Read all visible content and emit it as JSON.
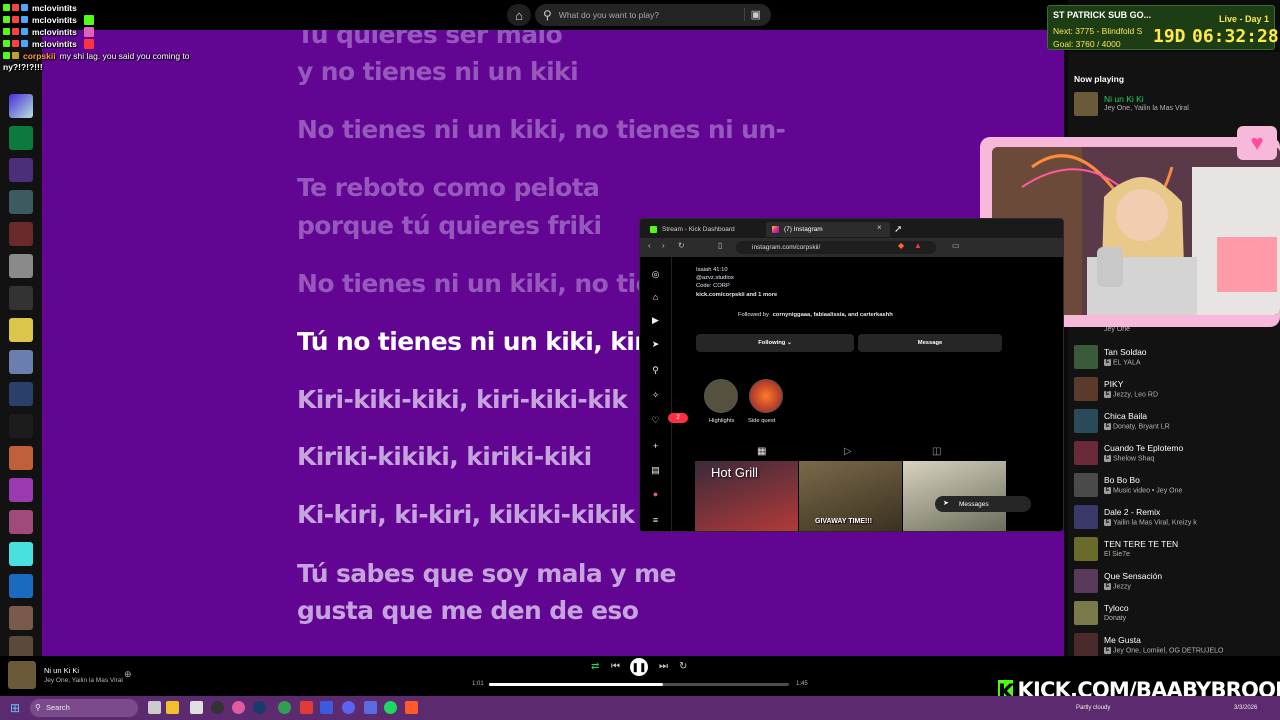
{
  "spotify": {
    "search_placeholder": "What do you want to play?",
    "lyrics": [
      {
        "text": "Tú quieres ser malo",
        "state": "past"
      },
      {
        "text": "y no tienes ni un kiki",
        "state": "past"
      },
      {
        "text": "No tienes ni un kiki, no tienes ni un-",
        "state": "past"
      },
      {
        "text": "Te reboto como pelota",
        "state": "past"
      },
      {
        "text": "porque tú quieres friki",
        "state": "past"
      },
      {
        "text": "No tienes ni un kiki, no tie",
        "state": "past"
      },
      {
        "text": "Tú no tienes ni un kiki, kiri",
        "state": "active"
      },
      {
        "text": "Kiri-kiki-kiki, kiri-kiki-kik",
        "state": "upcoming"
      },
      {
        "text": "Kiriki-kikiki, kiriki-kiki",
        "state": "upcoming"
      },
      {
        "text": "Ki-kiri, ki-kiri, kikiki-kikik",
        "state": "upcoming"
      },
      {
        "text": "Tú sabes que soy mala y me",
        "state": "upcoming"
      },
      {
        "text": "gusta que me den de eso",
        "state": "upcoming"
      }
    ],
    "queue": {
      "now_playing_heading": "Now playing",
      "now_playing": {
        "title": "Ni un Ki Ki",
        "artist": "Jey One, Yailin la Mas Viral"
      },
      "items": [
        {
          "title": "",
          "artist": "Jey One",
          "explicit": false
        },
        {
          "title": "Tan Soldao",
          "artist": "EL YALA",
          "explicit": true
        },
        {
          "title": "PIKY",
          "artist": "Jezzy, Leo RD",
          "explicit": true
        },
        {
          "title": "Chica Baila",
          "artist": "Donaty, Bryant LR",
          "explicit": true
        },
        {
          "title": "Cuando Te Eplotemo",
          "artist": "Shelow Shaq",
          "explicit": true
        },
        {
          "title": "Bo Bo Bo",
          "artist": "Music video • Jey One",
          "explicit": true
        },
        {
          "title": "Dale 2 - Remix",
          "artist": "Yailin la Mas Viral, Kreizy k",
          "explicit": true
        },
        {
          "title": "TEN TERE TE TEN",
          "artist": "El Sie7e",
          "explicit": false
        },
        {
          "title": "Que Sensación",
          "artist": "Jezzy",
          "explicit": true
        },
        {
          "title": "Tyloco",
          "artist": "Donaty",
          "explicit": false
        },
        {
          "title": "Me Gusta",
          "artist": "Jey One, Lomiiel, OG DETRUJELO",
          "explicit": true
        }
      ]
    },
    "player": {
      "title": "Ni un Ki Ki",
      "artist": "Jey One, Yailin la Mas Viral",
      "elapsed": "1:01",
      "duration": "1:45",
      "progress": 0.58
    }
  },
  "chat": {
    "lines": [
      {
        "user": "mclovintits",
        "message": "",
        "highlight": false
      },
      {
        "user": "mclovintits",
        "message": "",
        "highlight": false
      },
      {
        "user": "mclovintits",
        "message": "",
        "highlight": false
      },
      {
        "user": "mclovintits",
        "message": "",
        "highlight": false
      },
      {
        "user": "corpskii",
        "message": "my shi lag. you said you coming to",
        "highlight": true
      }
    ],
    "continuation": "ny?!?!?!!!"
  },
  "subathon": {
    "title": "ST PATRICK SUB GO...",
    "status": "Live - Day 1",
    "next": "Next: 3775 - Blindfold S",
    "goal": "Goal: 3760 / 4000",
    "days": "19D",
    "time": "06:32:28"
  },
  "browser": {
    "tabs": [
      {
        "label": "Stream - Kick Dashboard",
        "active": false
      },
      {
        "label": "(7) Instagram",
        "active": true
      }
    ],
    "url": "instagram.com/corpskii/",
    "profile": {
      "name_line": "Isaiah 41:10",
      "handle": "@azvz.studios",
      "code_line": "Code: CORP",
      "link_line": "kick.com/corpskii and 1 more",
      "followed_by": "Followed by",
      "followers_names": "cornyniggaaa, fabiaalissia, and carterkashh",
      "following_label": "Following",
      "message_label": "Message",
      "highlights": [
        {
          "label": "Highlights"
        },
        {
          "label": "Side quest"
        }
      ],
      "post_overlay_1": "Hot Grill",
      "post_overlay_2": "GIVAWAY TIME!!!",
      "messages_label": "Messages",
      "notif_count": "2"
    }
  },
  "kick_banner": {
    "text": "KICK.COM/BAABYBROOK",
    "brand_color": "#53fc18"
  },
  "taskbar": {
    "search_label": "Search",
    "weather": "Partly cloudy",
    "date": "3/3/2026"
  },
  "colors": {
    "lyrics_bg": "#610592",
    "spotify_green": "#1ed760",
    "subathon_bg": "#1d3d14",
    "subathon_text": "#ffe84a",
    "webcam_frame": "#f7b8d9",
    "taskbar_bg": "#5c2a6e"
  }
}
